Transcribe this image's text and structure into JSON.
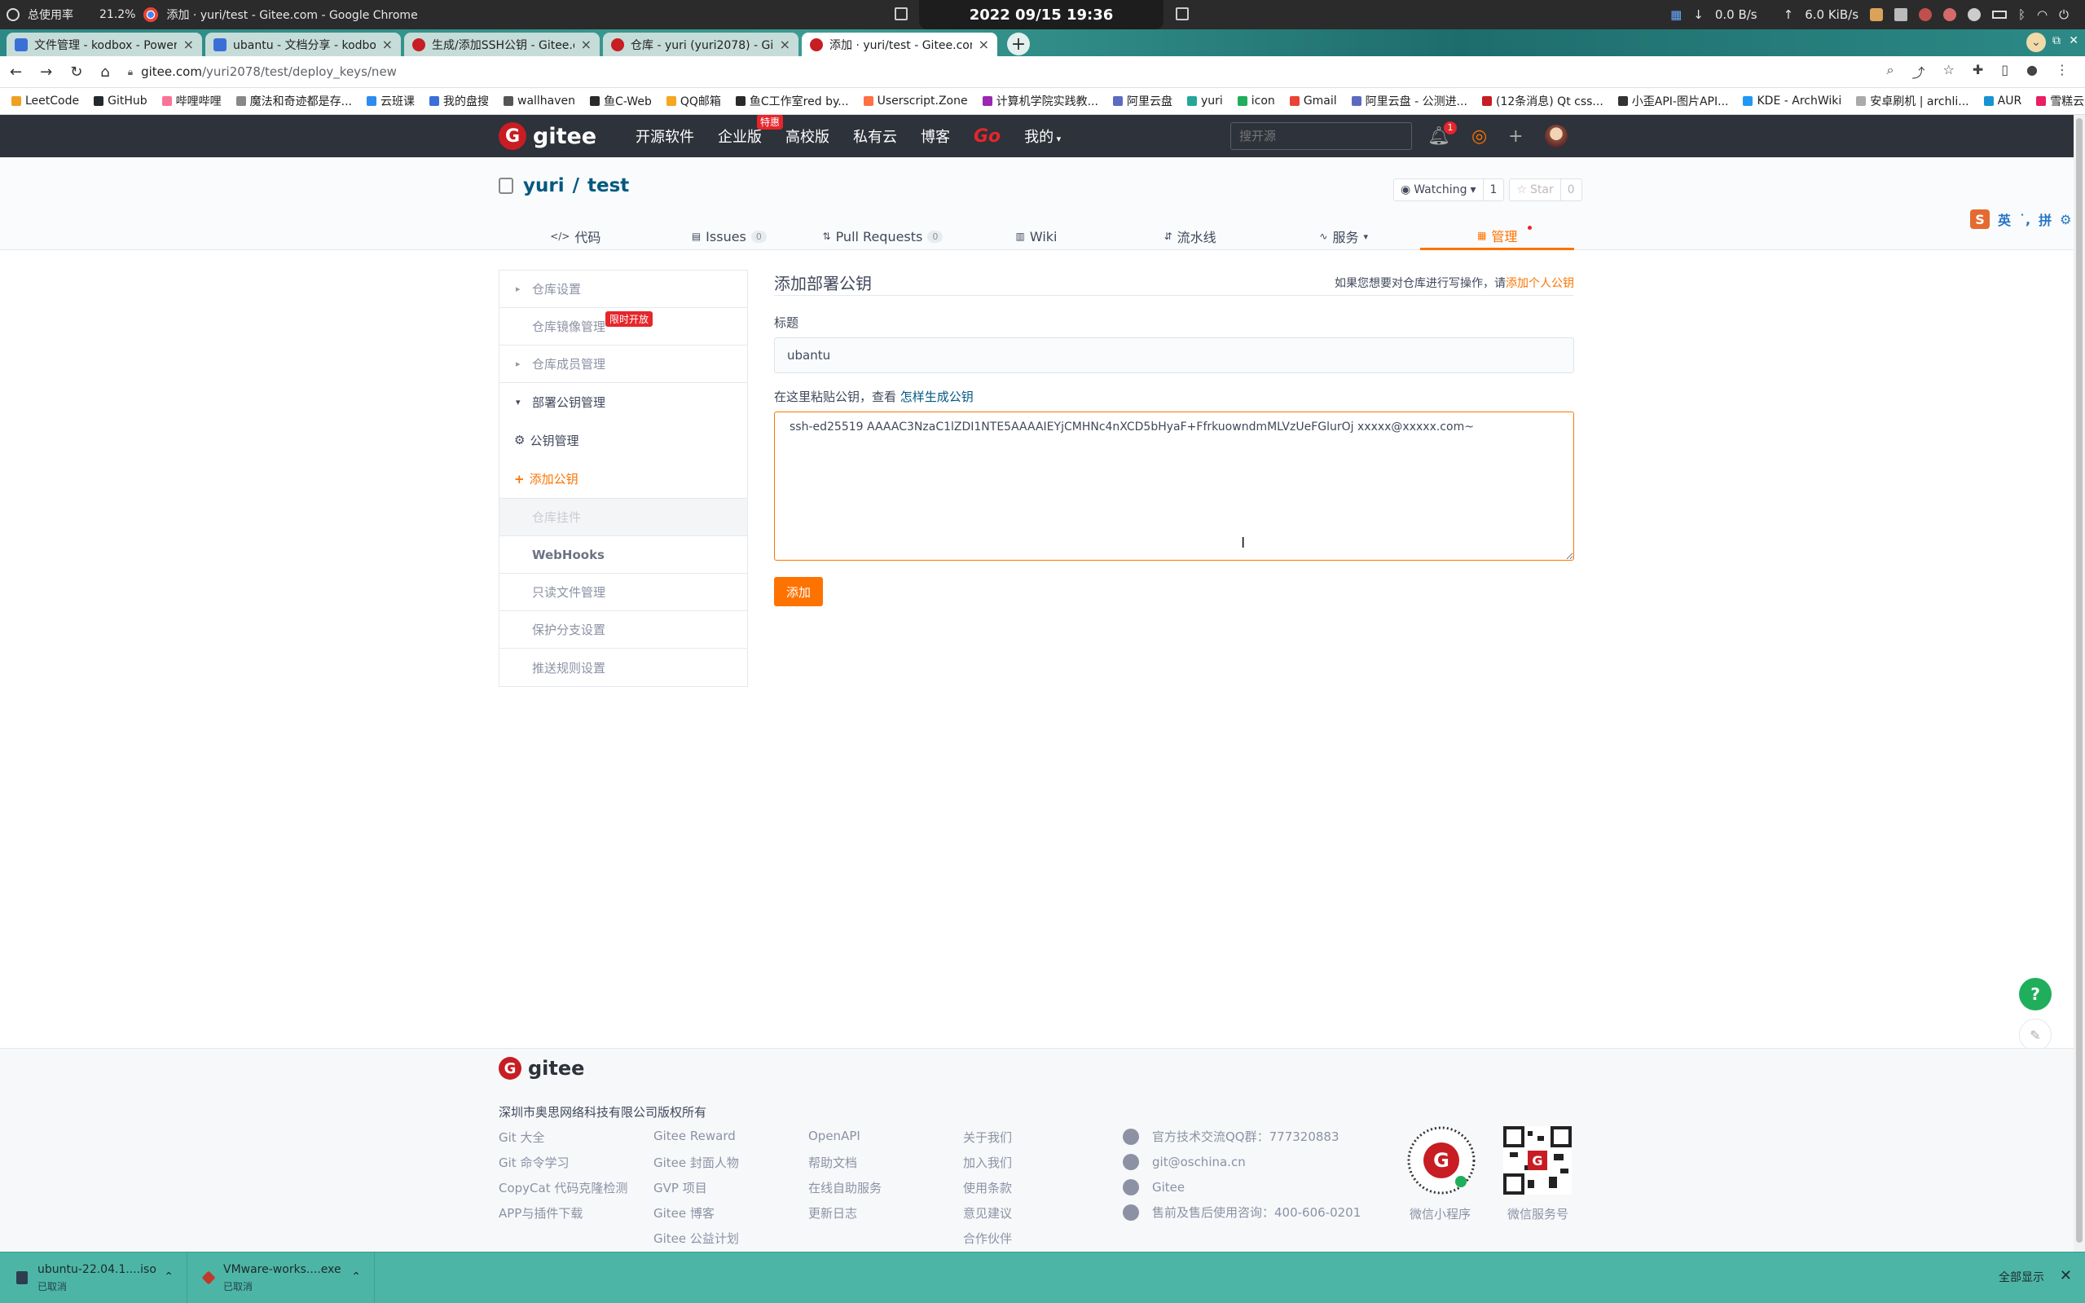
{
  "os": {
    "usage_label": "总使用率",
    "usage_pct": "21.2%",
    "window_title": "添加 · yuri/test - Gitee.com - Google Chrome",
    "clock": "2022 09/15 19:36",
    "net_down": "0.0 B/s",
    "net_up": "6.0 KiB/s"
  },
  "tabs": [
    {
      "title": "文件管理 - kodbox - Powered",
      "fav": "kod"
    },
    {
      "title": "ubantu - 文档分享 - kodbox -",
      "fav": "kod"
    },
    {
      "title": "生成/添加SSH公钥 - Gitee.com",
      "fav": "gitee"
    },
    {
      "title": "仓库 - yuri (yuri2078) - Gitee.c",
      "fav": "gitee"
    },
    {
      "title": "添加 · yuri/test - Gitee.com",
      "fav": "gitee",
      "active": true
    }
  ],
  "address": {
    "host": "gitee.com",
    "path": "/yuri2078/test/deploy_keys/new"
  },
  "bookmarks": [
    "LeetCode",
    "GitHub",
    "哔哩哔哩",
    "魔法和奇迹都是存...",
    "云班课",
    "我的盘搜",
    "wallhaven",
    "鱼C-Web",
    "QQ邮箱",
    "鱼C工作室red by...",
    "Userscript.Zone",
    "计算机学院实践教...",
    "阿里云盘",
    "yuri",
    "icon",
    "Gmail",
    "阿里云盘 - 公测进...",
    "(12条消息) Qt css...",
    "小歪API-图片API...",
    "KDE - ArchWiki",
    "安卓刷机 | archli...",
    "AUR",
    "雪糕云"
  ],
  "gitee": {
    "logo": "gitee",
    "nav": [
      "开源软件",
      "企业版",
      "高校版",
      "私有云",
      "博客",
      "Go",
      "我的"
    ],
    "enterprise_badge": "特惠",
    "search_placeholder": "搜开源",
    "notif_count": "1"
  },
  "repo": {
    "owner": "yuri",
    "name": "test",
    "watch_label": "Watching",
    "watch_count": "1",
    "star_label": "Star",
    "star_count": "0",
    "tabs": [
      {
        "icon": "</>",
        "label": "代码",
        "count": ""
      },
      {
        "icon": "▤",
        "label": "Issues",
        "count": "0"
      },
      {
        "icon": "⇅",
        "label": "Pull Requests",
        "count": "0"
      },
      {
        "icon": "▥",
        "label": "Wiki",
        "count": ""
      },
      {
        "icon": "⇵",
        "label": "流水线",
        "count": ""
      },
      {
        "icon": "∿",
        "label": "服务",
        "count": ""
      },
      {
        "icon": "▦",
        "label": "管理",
        "count": ""
      }
    ]
  },
  "sogou": {
    "lang": "英",
    "pinyin": "拼"
  },
  "sidebar": {
    "repo_settings": "仓库设置",
    "mirror": "仓库镜像管理",
    "mirror_tag": "限时开放",
    "members": "仓库成员管理",
    "deploy_keys": "部署公钥管理",
    "key_manage": "公钥管理",
    "add_key": "添加公钥",
    "attachments": "仓库挂件",
    "webhooks": "WebHooks",
    "readonly": "只读文件管理",
    "protect": "保护分支设置",
    "push_rules": "推送规则设置"
  },
  "form": {
    "title": "添加部署公钥",
    "hint_prefix": "如果您想要对仓库进行写操作，请",
    "hint_link": "添加个人公钥",
    "label_title": "标题",
    "title_value": "ubantu",
    "label_key_prefix": "在这里粘贴公钥，查看",
    "label_key_link": "怎样生成公钥",
    "key_value": "ssh-ed25519 AAAAC3NzaC1lZDI1NTE5AAAAIEYjCMHNc4nXCD5bHyaF+FfrkuowndmMLVzUeFGlurOj xxxxx@xxxxx.com~",
    "submit": "添加"
  },
  "footer": {
    "logo": "gitee",
    "company": "深圳市奥思网络科技有限公司版权所有",
    "col1": [
      "Git 大全",
      "Git 命令学习",
      "CopyCat 代码克隆检测",
      "APP与插件下载"
    ],
    "col2": [
      "Gitee Reward",
      "Gitee 封面人物",
      "GVP 项目",
      "Gitee 博客",
      "Gitee 公益计划"
    ],
    "col3": [
      "OpenAPI",
      "帮助文档",
      "在线自助服务",
      "更新日志"
    ],
    "col4": [
      "关于我们",
      "加入我们",
      "使用条款",
      "意见建议",
      "合作伙伴"
    ],
    "contact": [
      "官方技术交流QQ群：777320883",
      "git@oschina.cn",
      "Gitee",
      "售前及售后使用咨询：400-606-0201"
    ],
    "qr1_label": "微信小程序",
    "qr2_label": "微信服务号"
  },
  "downloads": {
    "items": [
      {
        "name": "ubuntu-22.04.1....iso",
        "status": "已取消"
      },
      {
        "name": "VMware-works....exe",
        "status": "已取消"
      }
    ],
    "show_all": "全部显示"
  },
  "colors": {
    "accent": "#fe7300",
    "brand": "#c71d23",
    "header": "#2e323a"
  }
}
